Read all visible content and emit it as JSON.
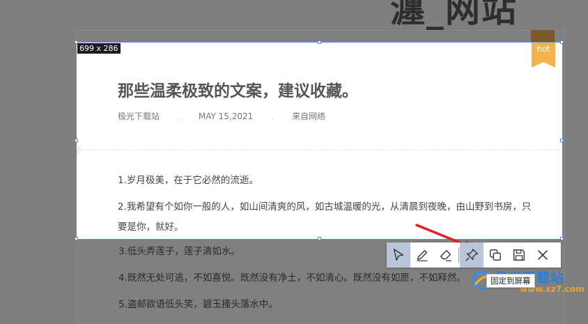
{
  "background": {
    "site_title": "瀍_网站"
  },
  "capture": {
    "size_label": "699 x 286"
  },
  "article": {
    "badge": "hot",
    "title": "那些温柔极致的文案，建议收藏。",
    "meta": {
      "author": "极光下载站",
      "date": "MAY 15,2021",
      "source": "来自网络"
    },
    "paragraphs": [
      "1.岁月极美，在于它必然的流逝。",
      "2.我希望有个如你一般的人，如山间清爽的风，如古城温暖的光，从清晨到夜晚，由山野到书房，只",
      "要是你，就好。"
    ],
    "dimmed_paragraphs": [
      "3.低头弄莲子，莲子清如水。",
      "4.既然无处可逃，不如喜悦。既然没有净土，不如清心。既然没有如愿，不如释然。",
      "5.盗邮欲语低头笑，碧玉搔头落水中。"
    ]
  },
  "toolbar": {
    "tools": [
      "select-tool",
      "pen-tool",
      "eraser-tool",
      "pin-tool",
      "copy-tool",
      "save-tool",
      "close-tool"
    ],
    "tooltip": "固定到屏幕"
  },
  "watermark": {
    "text": "极光下载站",
    "sub": "www.xz7.com"
  },
  "colors": {
    "selection_border": "#5a86d8",
    "ribbon": "#f2b44b",
    "arrow": "#e02020",
    "active_tool": "#b9c6da"
  }
}
